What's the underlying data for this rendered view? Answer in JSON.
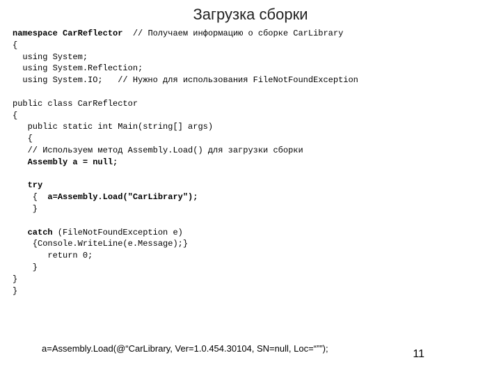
{
  "title": "Загрузка сборки",
  "code": {
    "l01a": "namespace CarReflector",
    "l01b": "  // Получаем информацию о сборке CarLibrary",
    "l02": "{",
    "l03": "  using System;",
    "l04": "  using System.Reflection;",
    "l05": "  using System.IO;   // Нужно для использования FileNotFoundException",
    "blank1": "",
    "l06": "public class CarReflector",
    "l07": "{",
    "l08": "   public static int Main(string[] args)",
    "l09": "   {",
    "l10": "   // Используем метод Assembly.Load() для загрузки сборки",
    "l11": "   Assembly a = null;",
    "blank2": "",
    "l12": "   try",
    "l13a": "    {  ",
    "l13b": "a=Assembly.Load(\"CarLibrary\");",
    "l14": "    }",
    "blank3": "",
    "l15a": "   catch",
    "l15b": " (FileNotFoundException e)",
    "l16": "    {Console.WriteLine(e.Message);}",
    "l17": "       return 0;",
    "l18": "    }",
    "l19": "}",
    "l20": "}"
  },
  "footer": "a=Assembly.Load(@“CarLibrary, Ver=1.0.454.30104, SN=null, Loc=“””);",
  "page": "11"
}
